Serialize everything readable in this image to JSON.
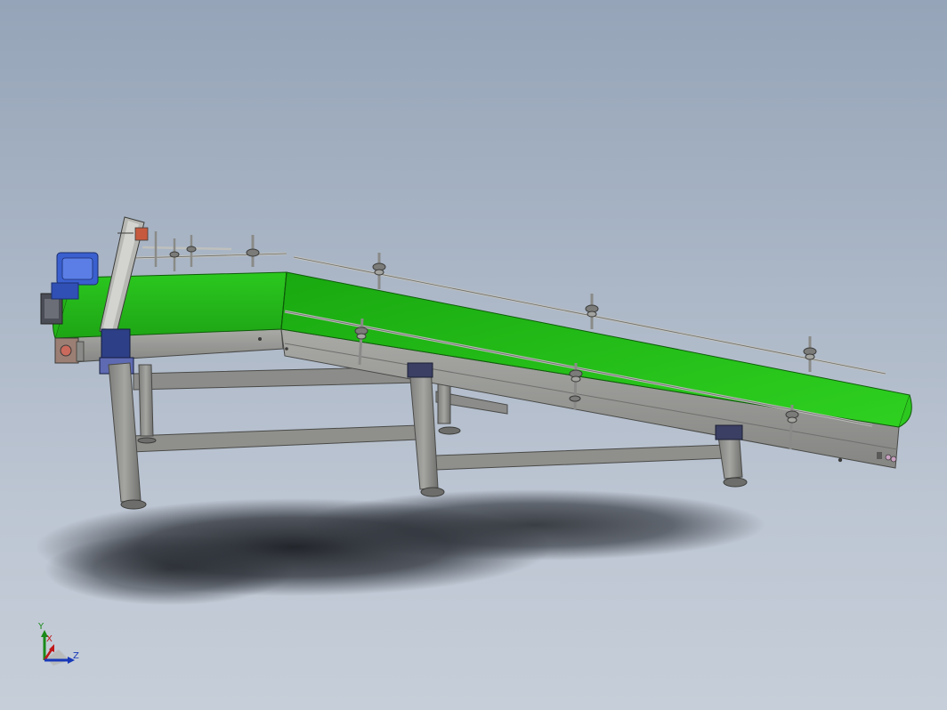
{
  "scene": {
    "subject": "inclined-belt-conveyor",
    "belt_color": "#22b51a",
    "frame_color": "#9a9a98",
    "motor_color": "#3a5fcf",
    "background_top": "#95a4b8",
    "background_bottom": "#c6ced9"
  },
  "triad": {
    "y_label": "Y",
    "x_label": "X",
    "z_label": "Z",
    "y_color": "#1a8a1a",
    "x_color": "#c01818",
    "z_color": "#1838b8"
  }
}
